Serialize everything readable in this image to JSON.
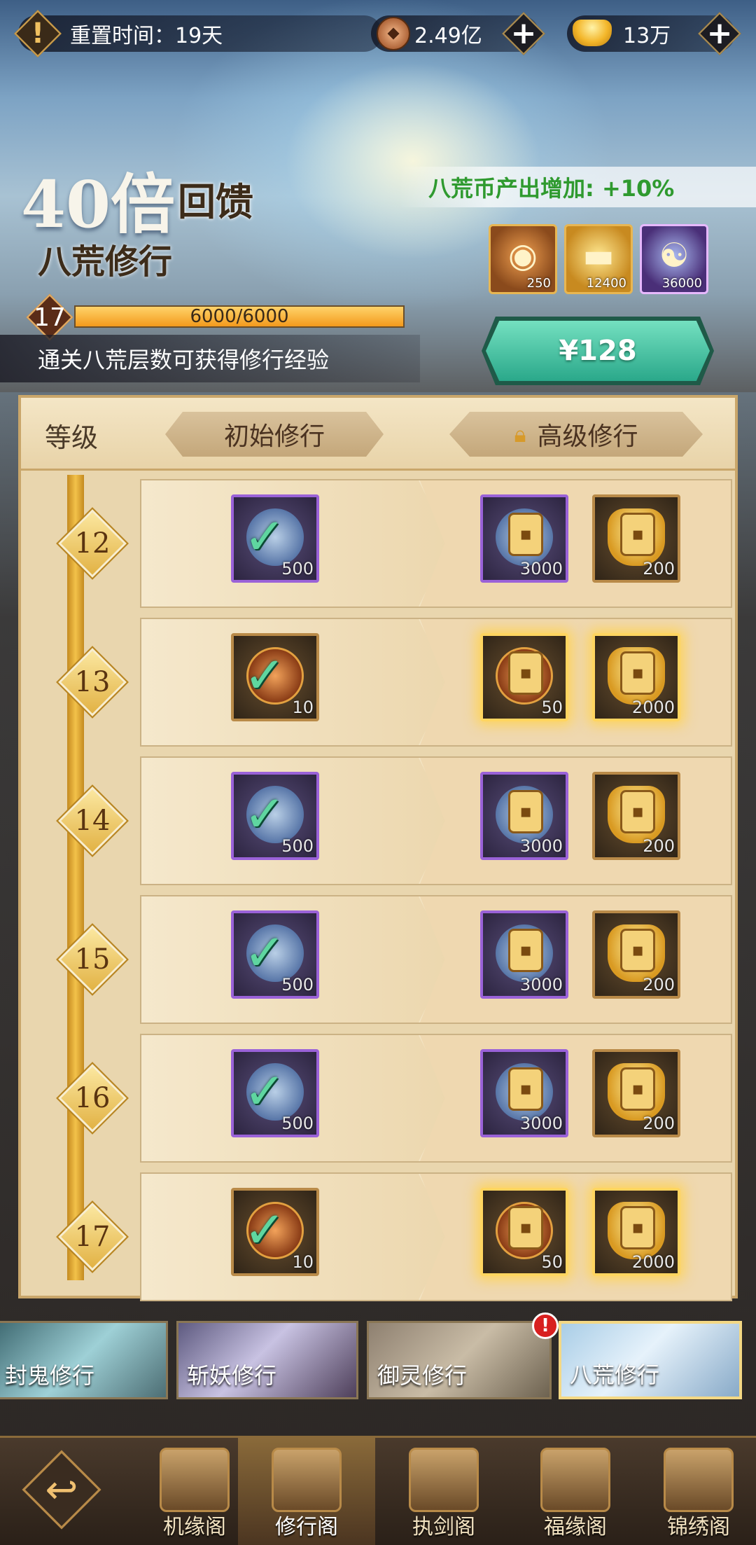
{
  "topbar": {
    "reset_label": "重置时间：19天",
    "coin_amount": "2.49亿",
    "gold_amount": "13万",
    "plus": "+"
  },
  "banner": {
    "multiplier": "40倍",
    "subtitle": "回馈",
    "mode_name": "八荒修行",
    "bonus_text": "八荒币产出增加: +10%",
    "rewards": [
      {
        "icon": "orange-coin-icon",
        "count": "250"
      },
      {
        "icon": "gold-ingot-icon",
        "count": "12400"
      },
      {
        "icon": "yinyang-orb-icon",
        "count": "36000"
      }
    ],
    "level": "17",
    "progress_text": "6000/6000",
    "progress_fraction": 1.0,
    "hint": "通关八荒层数可获得修行经验",
    "price": "¥128"
  },
  "table": {
    "header_level": "等级",
    "header_basic": "初始修行",
    "header_advanced": "高级修行",
    "rows": [
      {
        "level": "12",
        "basic_qty": "500",
        "adv1_qty": "3000",
        "adv2_qty": "200"
      },
      {
        "level": "13",
        "basic_qty": "10",
        "adv1_qty": "50",
        "adv2_qty": "2000"
      },
      {
        "level": "14",
        "basic_qty": "500",
        "adv1_qty": "3000",
        "adv2_qty": "200"
      },
      {
        "level": "15",
        "basic_qty": "500",
        "adv1_qty": "3000",
        "adv2_qty": "200"
      },
      {
        "level": "16",
        "basic_qty": "500",
        "adv1_qty": "3000",
        "adv2_qty": "200"
      },
      {
        "level": "17",
        "basic_qty": "10",
        "adv1_qty": "50",
        "adv2_qty": "2000"
      }
    ]
  },
  "modes": [
    "封鬼修行",
    "斩妖修行",
    "御灵修行",
    "八荒修行"
  ],
  "nav": [
    "机缘阁",
    "修行阁",
    "执剑阁",
    "福缘阁",
    "锦绣阁"
  ],
  "badge": "!"
}
